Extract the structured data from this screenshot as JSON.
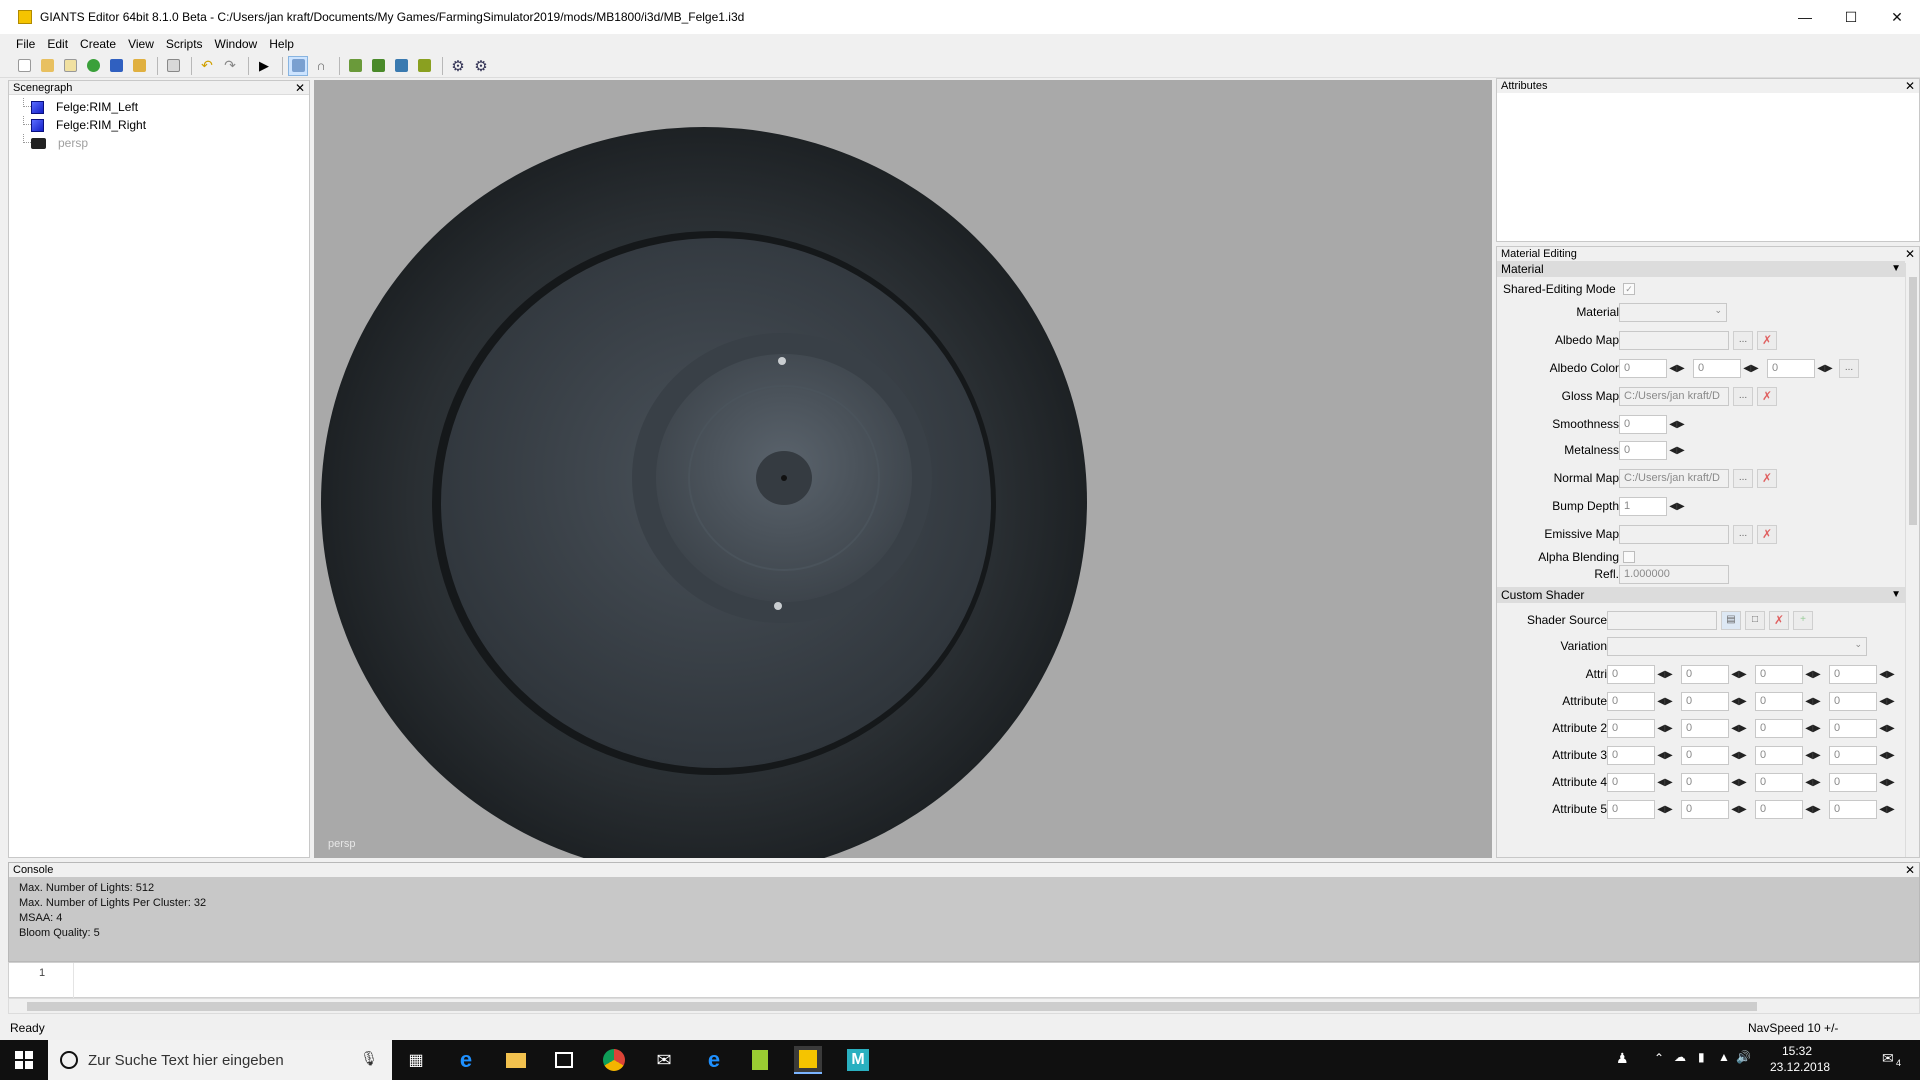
{
  "window": {
    "title": "GIANTS Editor 64bit 8.1.0 Beta - C:/Users/jan kraft/Documents/My Games/FarmingSimulator2019/mods/MB1800/i3d/MB_Felge1.i3d"
  },
  "menu": [
    "File",
    "Edit",
    "Create",
    "View",
    "Scripts",
    "Window",
    "Help"
  ],
  "scenegraph": {
    "title": "Scenegraph",
    "items": [
      {
        "label": "Felge:RIM_Left",
        "icon": "cube-icon"
      },
      {
        "label": "Felge:RIM_Right",
        "icon": "cube-icon"
      },
      {
        "label": "persp",
        "icon": "camera-icon"
      }
    ]
  },
  "viewport": {
    "camera_label": "persp"
  },
  "attributes": {
    "title": "Attributes"
  },
  "material_editing": {
    "title": "Material Editing",
    "material_section": "Material",
    "shared_editing_mode": "Shared-Editing Mode",
    "material": "Material",
    "albedo_map": "Albedo Map",
    "albedo_color": "Albedo Color",
    "albedo_color_values": [
      "0",
      "0",
      "0"
    ],
    "gloss_map": "Gloss Map",
    "gloss_map_value": "C:/Users/jan kraft/D",
    "smoothness": "Smoothness",
    "smoothness_value": "0",
    "metalness": "Metalness",
    "metalness_value": "0",
    "normal_map": "Normal Map",
    "normal_map_value": "C:/Users/jan kraft/D",
    "bump_depth": "Bump Depth",
    "bump_depth_value": "1",
    "emissive_map": "Emissive Map",
    "alpha_blending": "Alpha Blending",
    "refl": "Refl.",
    "refl_value": "1.000000",
    "custom_shader_section": "Custom Shader",
    "shader_source": "Shader Source",
    "variation": "Variation",
    "attr_rows": [
      {
        "label": "Attri",
        "values": [
          "0",
          "0",
          "0",
          "0"
        ]
      },
      {
        "label": "Attribute",
        "values": [
          "0",
          "0",
          "0",
          "0"
        ]
      },
      {
        "label": "Attribute 2",
        "values": [
          "0",
          "0",
          "0",
          "0"
        ]
      },
      {
        "label": "Attribute 3",
        "values": [
          "0",
          "0",
          "0",
          "0"
        ]
      },
      {
        "label": "Attribute 4",
        "values": [
          "0",
          "0",
          "0",
          "0"
        ]
      },
      {
        "label": "Attribute 5",
        "values": [
          "0",
          "0",
          "0",
          "0"
        ]
      }
    ]
  },
  "console": {
    "title": "Console",
    "lines": [
      "Max. Number of Lights: 512",
      "Max. Number of Lights Per Cluster: 32",
      "MSAA: 4",
      "Bloom Quality: 5"
    ],
    "line_number": "1"
  },
  "status": {
    "left": "Ready",
    "right": "NavSpeed 10 +/-"
  },
  "taskbar": {
    "search_placeholder": "Zur Suche Text hier eingeben",
    "time": "15:32",
    "date": "23.12.2018",
    "notification_count": "4"
  }
}
